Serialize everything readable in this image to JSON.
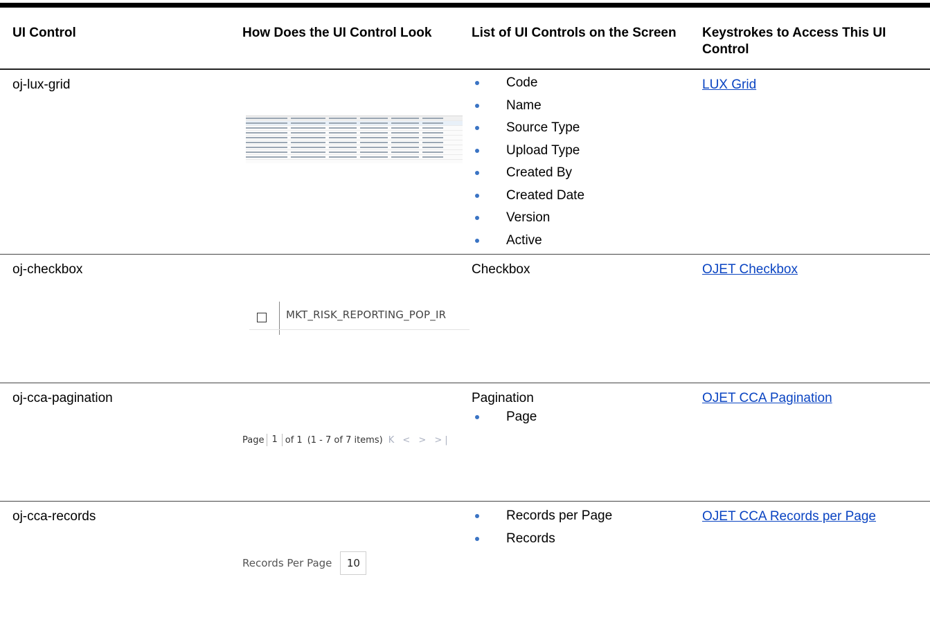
{
  "headers": {
    "col1": "UI Control",
    "col2": "How Does the UI Control Look",
    "col3": "List of UI Controls on the Screen",
    "col4": "Keystrokes to Access This UI Control"
  },
  "rows": [
    {
      "control": "oj-lux-grid",
      "controls_list": [
        "Code",
        "Name",
        "Source Type",
        "Upload Type",
        "Created By",
        "Created Date",
        "Version",
        "Active"
      ],
      "link": "LUX Grid"
    },
    {
      "control": "oj-checkbox",
      "controls_text": "Checkbox",
      "image_text": "MKT_RISK_REPORTING_POP_IR",
      "link": "OJET Checkbox"
    },
    {
      "control": "oj-cca-pagination",
      "controls_text": "Pagination",
      "controls_list": [
        "Page"
      ],
      "image": {
        "page_label": "Page",
        "page_value": "1",
        "of_text": "of 1",
        "range_text": "(1 - 7 of 7 items)",
        "nav_icons": "K < > >|"
      },
      "link": "OJET CCA Pagination"
    },
    {
      "control": "oj-cca-records",
      "controls_list": [
        "Records per Page",
        "Records"
      ],
      "image": {
        "label": "Records Per Page",
        "value": "10"
      },
      "link": "OJET CCA Records per Page"
    }
  ],
  "colors": {
    "link": "#0a44c2",
    "bullet": "#3a74c4"
  }
}
